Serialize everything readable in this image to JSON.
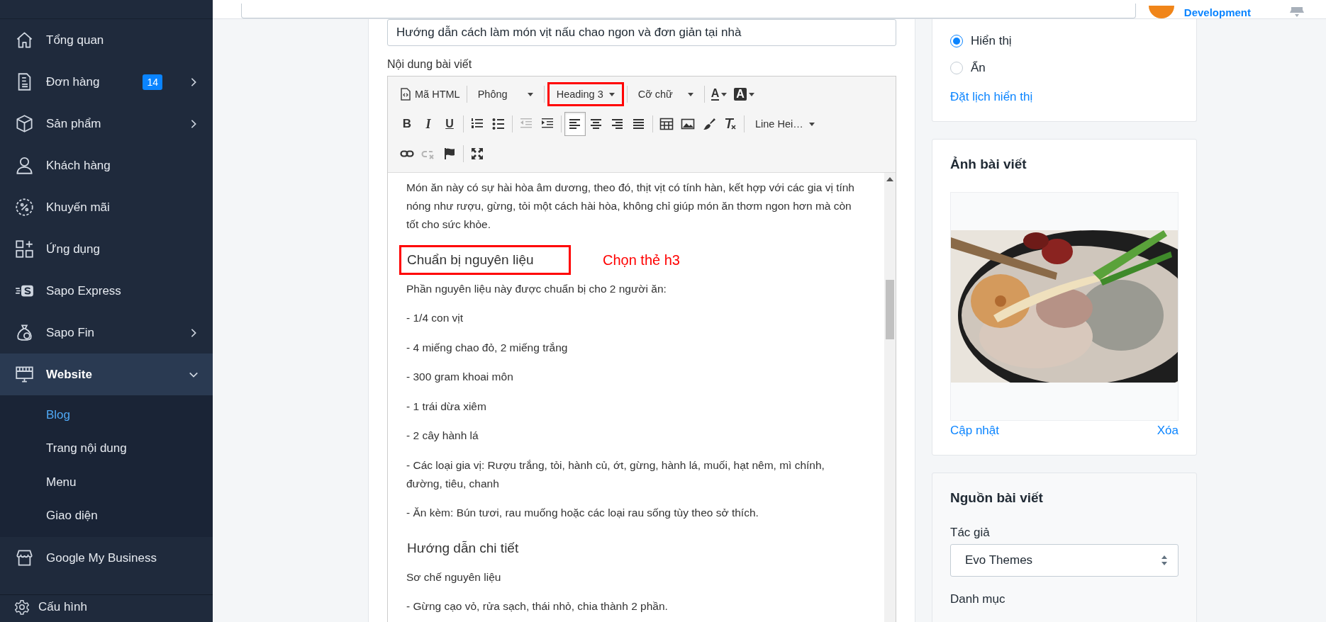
{
  "topbar": {
    "account": "Development"
  },
  "sidebar": {
    "items": [
      {
        "label": "Tổng quan",
        "selected": false
      },
      {
        "label": "Đơn hàng",
        "badge": "14",
        "expanded": false,
        "selected": false
      },
      {
        "label": "Sản phẩm",
        "expanded": false,
        "selected": false
      },
      {
        "label": "Khách hàng",
        "selected": false
      },
      {
        "label": "Khuyến mãi",
        "selected": false
      },
      {
        "label": "Ứng dụng",
        "selected": false
      },
      {
        "label": "Sapo Express",
        "selected": false
      },
      {
        "label": "Sapo Fin",
        "expanded": false,
        "selected": false
      },
      {
        "label": "Website",
        "expanded": true,
        "selected": true,
        "children": [
          {
            "label": "Blog",
            "selected": true
          },
          {
            "label": "Trang nội dung",
            "selected": false
          },
          {
            "label": "Menu",
            "selected": false
          },
          {
            "label": "Giao diện",
            "selected": false
          }
        ]
      },
      {
        "label": "Google My Business",
        "selected": false
      }
    ],
    "footer": "Cấu hình"
  },
  "editor": {
    "title_value": "Hướng dẫn cách làm món vịt nấu chao ngon và đơn giản tại nhà",
    "content_label": "Nội dung bài viết",
    "toolbar": [
      [
        [
          {
            "kind": "html",
            "label": "Mã HTML"
          }
        ],
        [
          {
            "kind": "dropdown",
            "label": "Phông",
            "highlighted": false
          }
        ],
        [
          {
            "kind": "dropdown",
            "label": "Heading 3",
            "highlighted": true
          }
        ],
        [
          {
            "kind": "dropdown",
            "label": "Cỡ chữ",
            "highlighted": false
          }
        ],
        [
          {
            "kind": "color",
            "label": "A"
          },
          {
            "kind": "bgcolor",
            "label": "A"
          }
        ]
      ],
      [
        [
          {
            "kind": "text",
            "label": "B"
          },
          {
            "kind": "text",
            "label": "I"
          },
          {
            "kind": "text",
            "label": "U"
          }
        ],
        [
          {
            "kind": "icon",
            "selected": false,
            "disabled": false
          },
          {
            "kind": "icon",
            "selected": false,
            "disabled": false
          }
        ],
        [
          {
            "kind": "icon",
            "selected": false,
            "disabled": true
          },
          {
            "kind": "icon",
            "selected": false,
            "disabled": false
          }
        ],
        [
          {
            "kind": "icon",
            "selected": true,
            "disabled": false
          },
          {
            "kind": "icon",
            "selected": false,
            "disabled": false
          },
          {
            "kind": "icon",
            "selected": false,
            "disabled": false
          },
          {
            "kind": "icon",
            "selected": false,
            "disabled": false
          }
        ],
        [
          {
            "kind": "icon",
            "selected": false,
            "disabled": false
          },
          {
            "kind": "icon",
            "selected": false,
            "disabled": false
          },
          {
            "kind": "icon",
            "selected": false,
            "disabled": false
          },
          {
            "kind": "icon",
            "selected": false,
            "disabled": false
          }
        ],
        [
          {
            "kind": "dropdown",
            "label": "Line Hei…",
            "highlighted": false
          }
        ]
      ],
      [
        [
          {
            "kind": "icon",
            "selected": false,
            "disabled": false
          },
          {
            "kind": "icon",
            "selected": false,
            "disabled": true
          },
          {
            "kind": "icon",
            "selected": false,
            "disabled": false
          }
        ],
        [
          {
            "kind": "icon",
            "selected": false,
            "disabled": false
          }
        ]
      ]
    ],
    "blocks": [
      {
        "kind": "p",
        "text": "Món ăn này có sự hài hòa âm dương, theo đó, thịt vịt có tính hàn, kết hợp với các gia vị tính nóng như rượu, gừng, tỏi một cách hài hòa, không chỉ giúp món ăn thơm ngon hơn mà còn tốt cho sức khỏe."
      },
      {
        "kind": "h3",
        "text": "Chuẩn bị nguyên liệu",
        "highlighted": true,
        "annotation": "Chọn thẻ h3"
      },
      {
        "kind": "p",
        "text": "Phần nguyên liệu này được chuẩn bị cho 2 người ăn:"
      },
      {
        "kind": "p",
        "text": "- 1/4 con vịt"
      },
      {
        "kind": "p",
        "text": "- 4 miếng chao đỏ, 2 miếng trắng"
      },
      {
        "kind": "p",
        "text": "- 300 gram khoai môn"
      },
      {
        "kind": "p",
        "text": "- 1 trái dừa xiêm"
      },
      {
        "kind": "p",
        "text": "- 2 cây hành lá"
      },
      {
        "kind": "p",
        "text": "- Các loại gia vị: Rượu trắng, tỏi, hành củ, ớt, gừng, hành lá, muối, hạt nêm, mì chính, đường, tiêu, chanh"
      },
      {
        "kind": "p",
        "text": "- Ăn kèm: Bún tươi, rau muống hoặc các loại rau sống tùy theo sở thích."
      },
      {
        "kind": "h3",
        "text": "Hướng dẫn chi tiết",
        "highlighted": false
      },
      {
        "kind": "p",
        "text": "Sơ chế nguyên liệu"
      },
      {
        "kind": "p",
        "text": "- Gừng cạo vỏ, rửa sạch, thái nhỏ, chia thành 2 phần."
      }
    ]
  },
  "visibility": {
    "options": [
      {
        "label": "Hiển thị",
        "selected": true
      },
      {
        "label": "Ẩn",
        "selected": false
      }
    ],
    "schedule_link": "Đặt lịch hiển thị"
  },
  "image_card": {
    "title": "Ảnh bài viết",
    "update_link": "Cập nhật",
    "delete_link": "Xóa"
  },
  "source_card": {
    "title": "Nguồn bài viết",
    "author_label": "Tác giả",
    "author_value": "Evo Themes",
    "category_label": "Danh mục"
  }
}
